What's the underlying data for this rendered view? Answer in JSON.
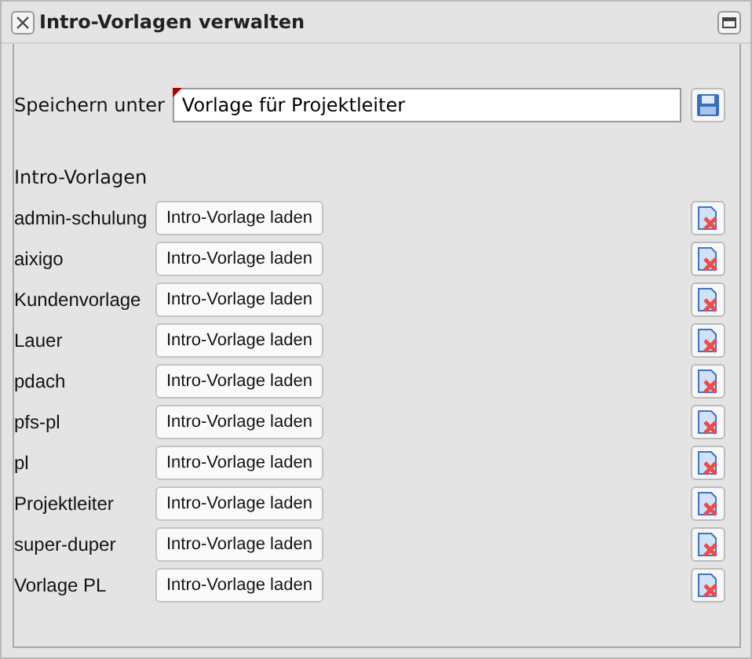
{
  "window": {
    "title": "Intro-Vorlagen verwalten"
  },
  "save": {
    "label": "Speichern unter",
    "value": "Vorlage für Projektleiter"
  },
  "section_title": "Intro-Vorlagen",
  "templates": [
    {
      "name": "admin-schulung",
      "load_label": "Intro-Vorlage laden"
    },
    {
      "name": "aixigo",
      "load_label": "Intro-Vorlage laden"
    },
    {
      "name": "Kundenvorlage",
      "load_label": "Intro-Vorlage laden"
    },
    {
      "name": "Lauer",
      "load_label": "Intro-Vorlage laden"
    },
    {
      "name": "pdach",
      "load_label": "Intro-Vorlage laden"
    },
    {
      "name": "pfs-pl",
      "load_label": "Intro-Vorlage laden"
    },
    {
      "name": "pl",
      "load_label": "Intro-Vorlage laden"
    },
    {
      "name": "Projektleiter",
      "load_label": "Intro-Vorlage laden"
    },
    {
      "name": "super-duper",
      "load_label": "Intro-Vorlage laden"
    },
    {
      "name": "Vorlage PL",
      "load_label": "Intro-Vorlage laden"
    }
  ]
}
